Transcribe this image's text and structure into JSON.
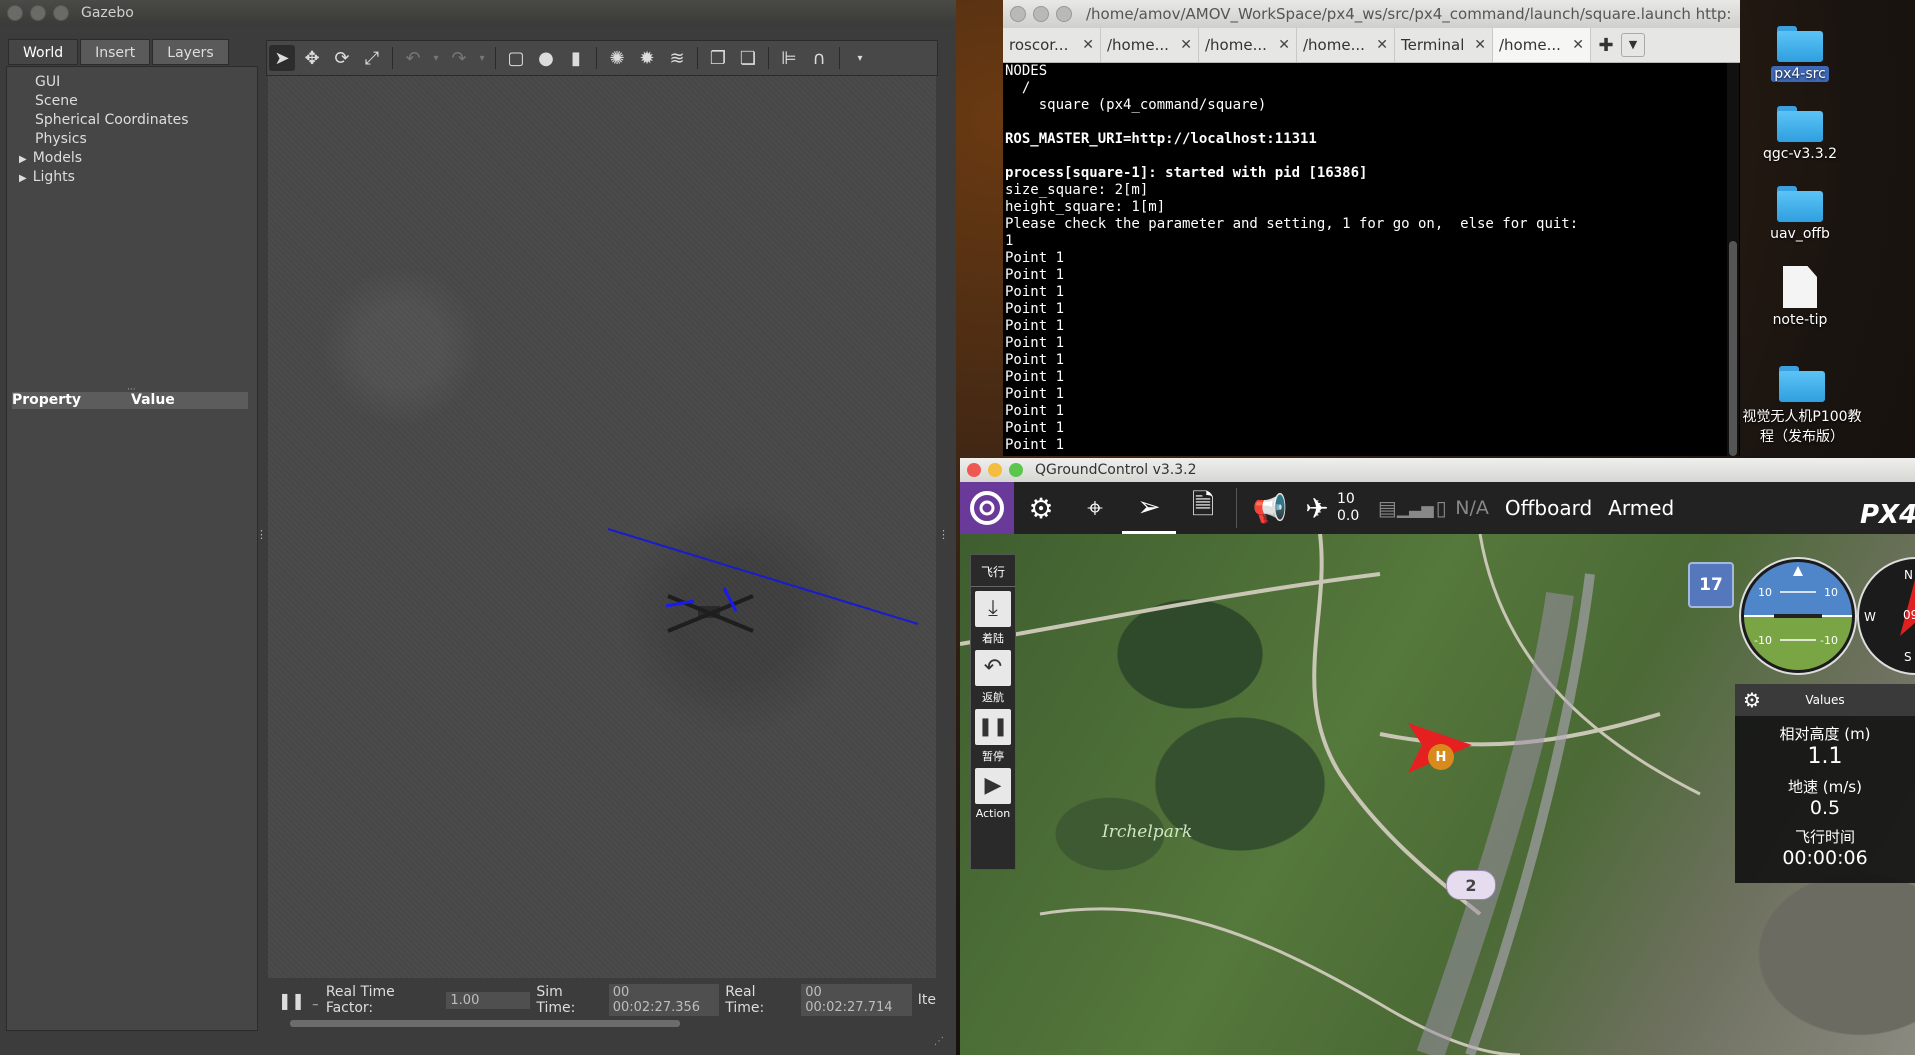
{
  "desktop": {
    "icons": [
      {
        "label": "px4-src",
        "kind": "folder",
        "selected": true
      },
      {
        "label": "qgc-v3.3.2",
        "kind": "folder",
        "selected": false
      },
      {
        "label": "uav_offb",
        "kind": "folder",
        "selected": false
      },
      {
        "label": "note-tip",
        "kind": "file",
        "selected": false
      },
      {
        "label": "视觉无人机P100教程（发布版）",
        "kind": "folder",
        "selected": false
      }
    ]
  },
  "gazebo": {
    "title": "Gazebo",
    "tabs": [
      "World",
      "Insert",
      "Layers"
    ],
    "tree": [
      "GUI",
      "Scene",
      "Spherical Coordinates",
      "Physics",
      "Models",
      "Lights"
    ],
    "prop_header": {
      "property": "Property",
      "value": "Value"
    },
    "status": {
      "rtf_label": "Real Time Factor:",
      "rtf_value": "1.00",
      "sim_label": "Sim Time:",
      "sim_value": "00 00:02:27.356",
      "real_label": "Real Time:",
      "real_value": "00 00:02:27.714",
      "iter_label": "Ite"
    }
  },
  "terminal": {
    "title": "/home/amov/AMOV_WorkSpace/px4_ws/src/px4_command/launch/square.launch http:",
    "tabs": [
      "roscor...",
      "/home...",
      "/home...",
      "/home...",
      "Terminal",
      "/home..."
    ],
    "lines": [
      {
        "t": "NODES",
        "b": false
      },
      {
        "t": "  /",
        "b": false
      },
      {
        "t": "    square (px4_command/square)",
        "b": false
      },
      {
        "t": "",
        "b": false
      },
      {
        "t": "ROS_MASTER_URI=http://localhost:11311",
        "b": true
      },
      {
        "t": "",
        "b": false
      },
      {
        "t": "process[square-1]: started with pid [16386]",
        "b": true
      },
      {
        "t": "size_square: 2[m]",
        "b": false
      },
      {
        "t": "height_square: 1[m]",
        "b": false
      },
      {
        "t": "Please check the parameter and setting, 1 for go on,  else for quit:",
        "b": false
      },
      {
        "t": "1",
        "b": false
      },
      {
        "t": "Point 1",
        "b": false
      },
      {
        "t": "Point 1",
        "b": false
      },
      {
        "t": "Point 1",
        "b": false
      },
      {
        "t": "Point 1",
        "b": false
      },
      {
        "t": "Point 1",
        "b": false
      },
      {
        "t": "Point 1",
        "b": false
      },
      {
        "t": "Point 1",
        "b": false
      },
      {
        "t": "Point 1",
        "b": false
      },
      {
        "t": "Point 1",
        "b": false
      },
      {
        "t": "Point 1",
        "b": false
      },
      {
        "t": "Point 1",
        "b": false
      },
      {
        "t": "Point 1",
        "b": false
      }
    ]
  },
  "qgc": {
    "title": "QGroundControl v3.3.2",
    "sat_count": "10",
    "hdop": "0.0",
    "battery": "N/A",
    "mode": "Offboard",
    "armed": "Armed",
    "logo": "PX4",
    "side_title": "飞行",
    "side": [
      {
        "label": "着陆",
        "icon": "land-icon"
      },
      {
        "label": "返航",
        "icon": "rtl-icon"
      },
      {
        "label": "暂停",
        "icon": "pause-icon"
      },
      {
        "label": "Action",
        "icon": "play-icon"
      }
    ],
    "map_label": "Irchelpark",
    "home_marker": "H",
    "waypoint": "2",
    "zoom_badge": "17",
    "attitude": {
      "top_left": "10",
      "top_right": "10",
      "bottom_left": "-10",
      "bottom_right": "-10"
    },
    "compass": {
      "w": "W",
      "n": "N",
      "heading": "09",
      "s": "S"
    },
    "values": {
      "header": "Values",
      "items": [
        {
          "label": "相对高度 (m)",
          "value": "1.1"
        },
        {
          "label": "地速 (m/s)",
          "value": "0.5"
        },
        {
          "label": "飞行时间",
          "value": "00:00:06"
        }
      ]
    },
    "colors": {
      "accent": "#6a3a9a",
      "selected_icon": "#3d68b8"
    }
  }
}
